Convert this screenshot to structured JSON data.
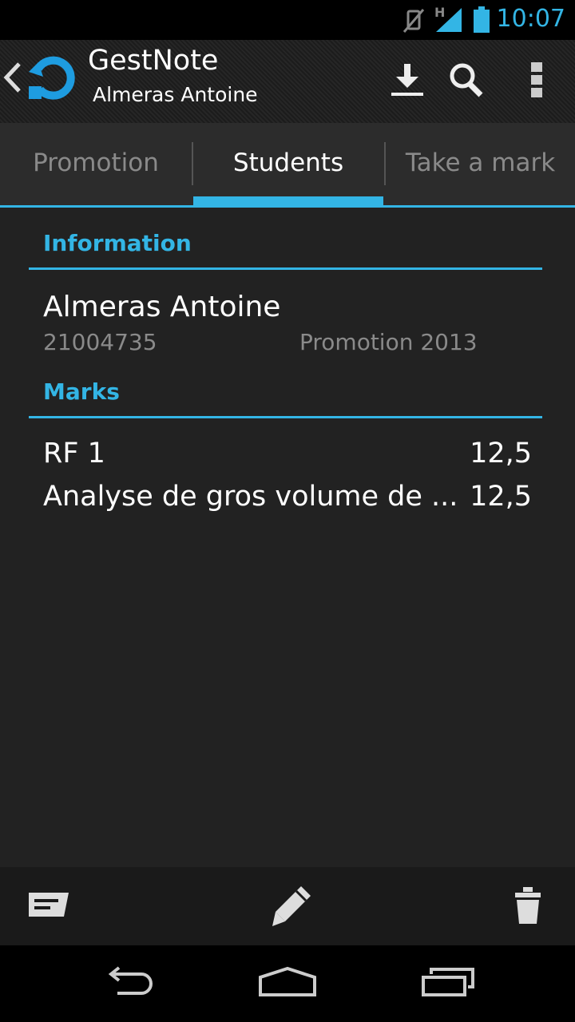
{
  "status_bar": {
    "time": "10:07",
    "network_type": "H",
    "icons": [
      "vibrate-off-icon",
      "signal-icon",
      "battery-icon"
    ],
    "accent_color": "#33b5e5"
  },
  "action_bar": {
    "app_title": "GestNote",
    "subtitle": "Almeras Antoine",
    "actions": [
      "download-icon",
      "search-icon",
      "overflow-menu-icon"
    ]
  },
  "tabs": [
    {
      "label": "Promotion",
      "selected": false
    },
    {
      "label": "Students",
      "selected": true
    },
    {
      "label": "Take a mark",
      "selected": false
    }
  ],
  "information": {
    "header": "Information",
    "student_name": "Almeras Antoine",
    "student_id": "21004735",
    "promotion": "Promotion 2013"
  },
  "marks": {
    "header": "Marks",
    "items": [
      {
        "name": "RF 1",
        "value": "12,5"
      },
      {
        "name": "Analyse de gros volume de ...",
        "value": "12,5"
      }
    ]
  },
  "bottom_bar": {
    "actions": [
      "comment-icon",
      "edit-pencil-icon",
      "delete-trash-icon"
    ]
  },
  "nav_bar": {
    "buttons": [
      "back-icon",
      "home-icon",
      "recent-apps-icon"
    ]
  },
  "colors": {
    "accent": "#33b5e5",
    "background": "#222222",
    "tab_background": "#2c2c2c",
    "secondary_text": "#8a8a8a"
  }
}
